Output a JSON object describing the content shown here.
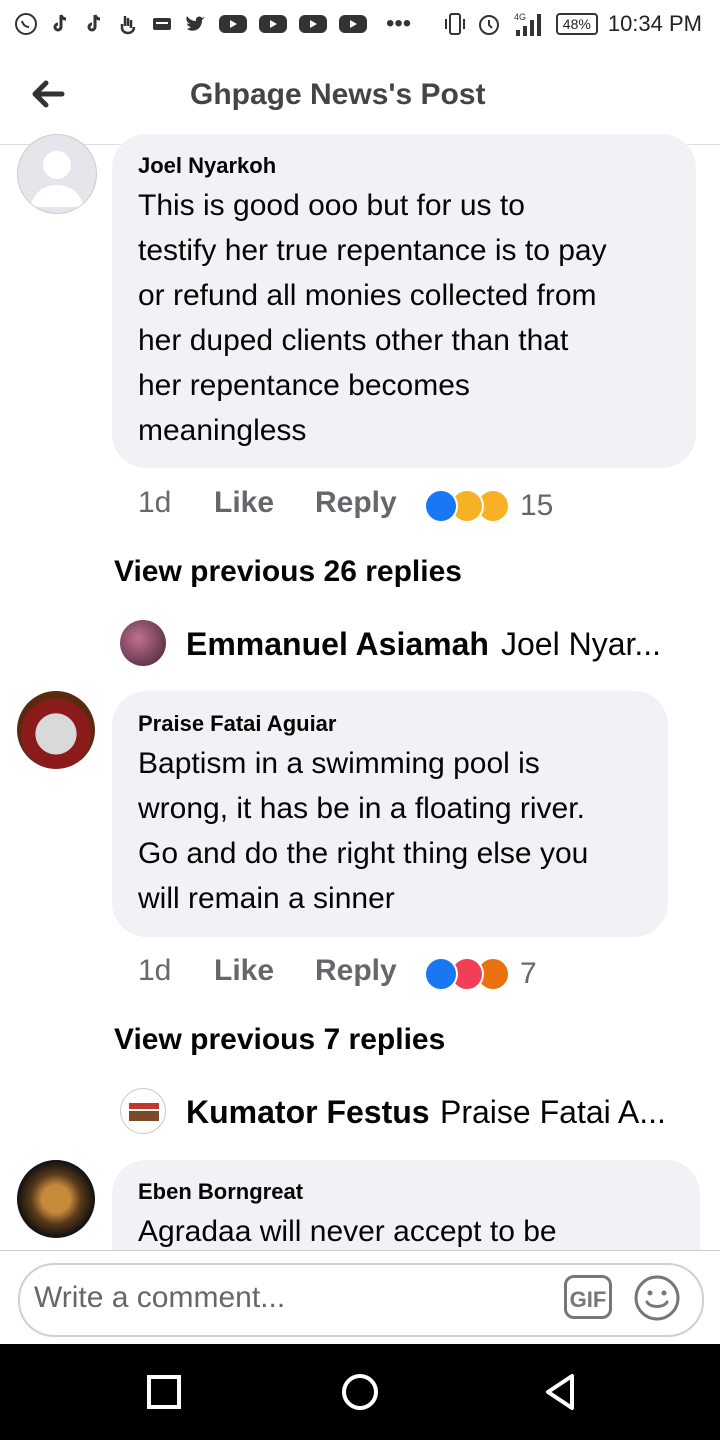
{
  "status_bar": {
    "time": "10:34 PM",
    "battery": "48%",
    "network": "4G",
    "icons": [
      "whatsapp-icon",
      "tiktok-icon",
      "tiktok-icon",
      "hand-icon",
      "message-icon",
      "twitter-icon",
      "youtube-icon",
      "youtube-icon",
      "youtube-icon",
      "youtube-icon",
      "more-icon",
      "vibrate-icon",
      "alarm-icon",
      "signal-icon"
    ]
  },
  "header": {
    "title": "Ghpage News's Post"
  },
  "comments": [
    {
      "author": "Joel Nyarkoh",
      "lines": [
        "This is good ooo but for us to",
        "testify her true repentance is to pay",
        "or refund all monies collected from",
        "her duped clients other than that",
        "her repentance becomes",
        "meaningless"
      ],
      "time": "1d",
      "like": "Like",
      "reply": "Reply",
      "reaction_count": "15",
      "reactions": [
        "like",
        "haha",
        "care"
      ],
      "view_previous": "View previous 26 replies",
      "latest_reply": {
        "name": "Emmanuel Asiamah",
        "text": "Joel Nyar..."
      }
    },
    {
      "author": "Praise Fatai Aguiar",
      "lines": [
        "Baptism in a swimming pool is",
        "wrong, it has be in a floating river.",
        "Go and do the right thing else you",
        "will remain a sinner"
      ],
      "time": "1d",
      "like": "Like",
      "reply": "Reply",
      "reaction_count": "7",
      "reactions": [
        "like",
        "love",
        "angry"
      ],
      "view_previous": "View previous 7 replies",
      "latest_reply": {
        "name": "Kumator Festus",
        "text": "Praise Fatai A..."
      }
    },
    {
      "author": "Eben Borngreat",
      "lines": [
        "Agradaa will never accept to be"
      ]
    }
  ],
  "composer": {
    "placeholder": "Write a comment...",
    "gif_label": "GIF"
  },
  "colors": {
    "bubble": "#f0f2f5",
    "like_blue": "#1877f2",
    "love_red": "#f33e58",
    "haha_yellow": "#f7b125",
    "angry_orange": "#e9710f",
    "meta_gray": "#65676b"
  }
}
